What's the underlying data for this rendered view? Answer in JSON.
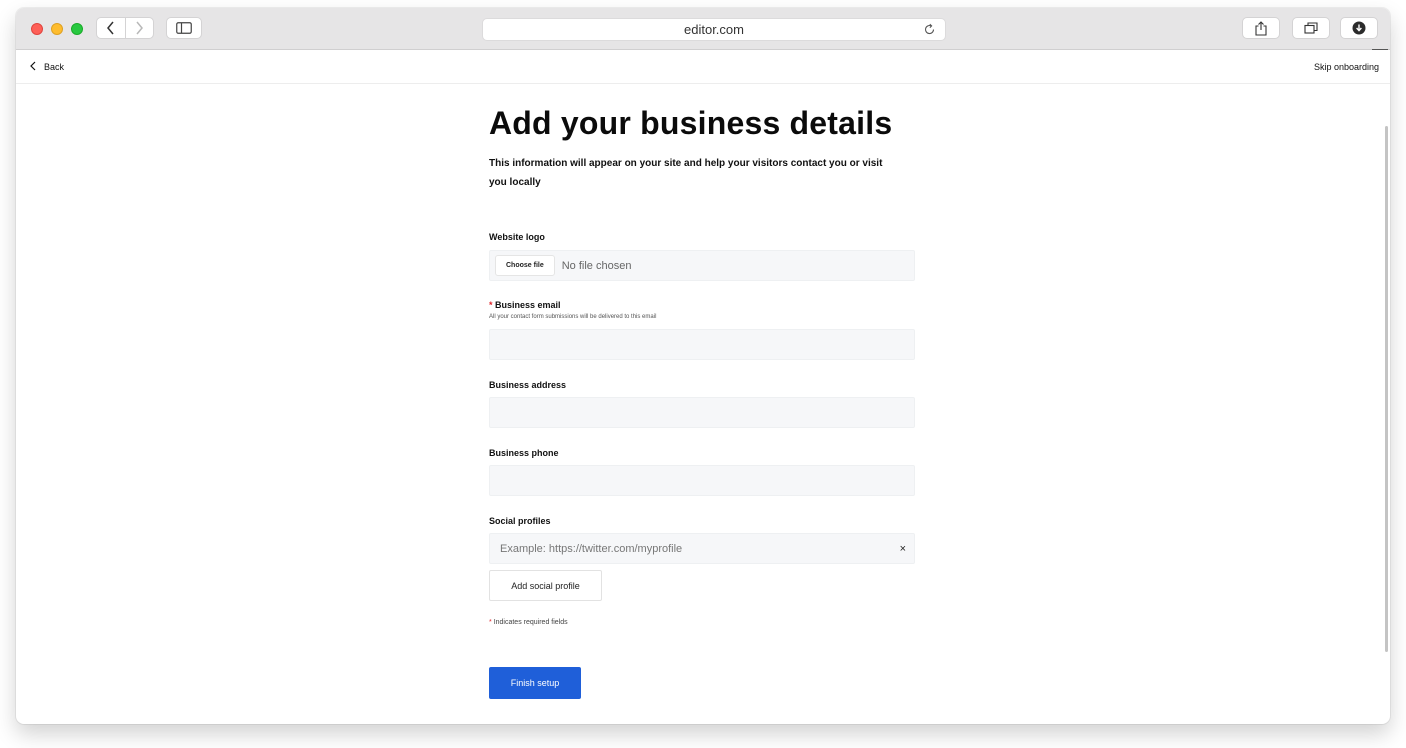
{
  "browser": {
    "url": "editor.com",
    "icons": [
      "back-arrow-icon",
      "forward-arrow-icon",
      "sidebar-icon",
      "reload-icon",
      "share-icon",
      "tabs-icon",
      "download-icon"
    ]
  },
  "topbar": {
    "back_label": "Back",
    "skip_label": "Skip onboarding"
  },
  "page": {
    "title": "Add your business details",
    "subtitle": "This information will appear on your site and help your visitors contact you or visit you locally"
  },
  "form": {
    "logo": {
      "label": "Website logo",
      "button_label": "Choose file",
      "status": "No file chosen"
    },
    "email": {
      "required_marker": "*",
      "label": "Business email",
      "helper": "All your contact form submissions will be delivered to this email",
      "value": ""
    },
    "address": {
      "label": "Business address",
      "value": ""
    },
    "phone": {
      "label": "Business phone",
      "value": ""
    },
    "social": {
      "label": "Social profiles",
      "placeholder": "Example: https://twitter.com/myprofile",
      "clear_label": "×",
      "add_label": "Add social profile"
    },
    "required_note": {
      "marker": "*",
      "text": "Indicates required fields"
    },
    "submit_label": "Finish setup"
  },
  "colors": {
    "primary": "#1f5fd9",
    "required": "#e0252b",
    "field_bg": "#f6f7f9"
  }
}
